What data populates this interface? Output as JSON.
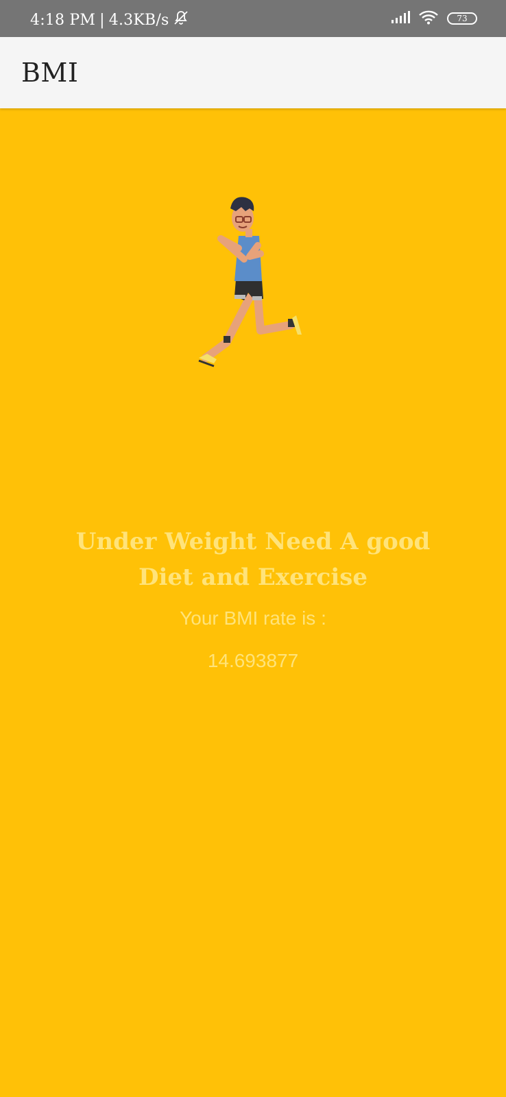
{
  "status_bar": {
    "time": "4:18 PM",
    "separator": "|",
    "network_speed": "4.3KB/s",
    "battery": "73",
    "icons": [
      "bell-off-icon",
      "signal-icon",
      "wifi-icon",
      "battery-icon"
    ]
  },
  "app_bar": {
    "title": "BMI"
  },
  "illustration": {
    "name": "running-man-illustration"
  },
  "result": {
    "message": "Under Weight Need A good Diet and Exercise",
    "rate_label": "Your BMI rate is :",
    "rate_value": "14.693877"
  },
  "colors": {
    "background": "#FFC107",
    "app_bar": "#F5F5F5",
    "status_bar": "#757575",
    "result_text": "#FFE37A"
  }
}
